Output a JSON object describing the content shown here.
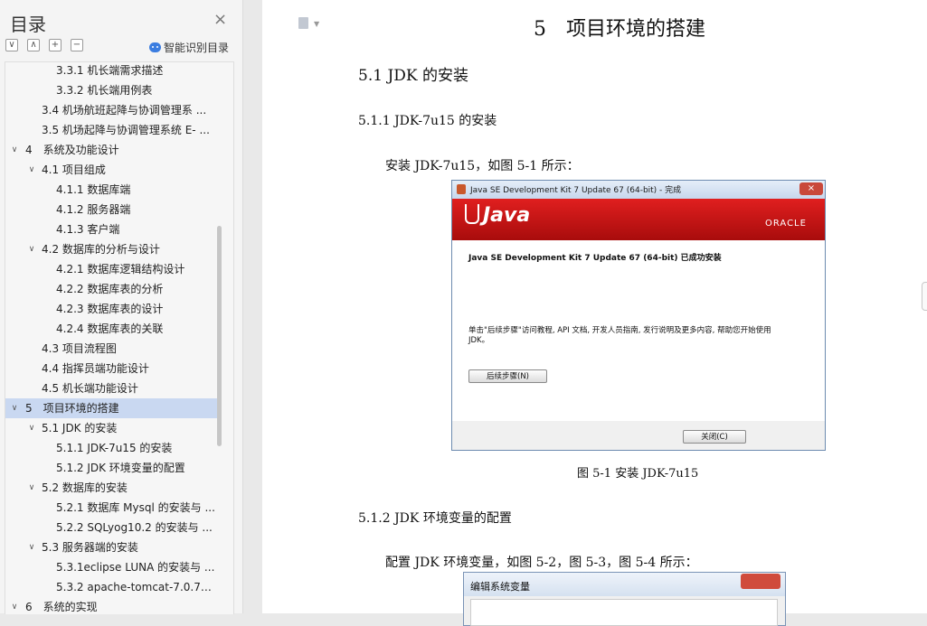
{
  "toc": {
    "title": "目录",
    "close_icon": "×",
    "tools": [
      "∨",
      "∧",
      "+",
      "−"
    ],
    "smart_label": "智能识别目录",
    "items": [
      {
        "label": "3.3.1 机长端需求描述",
        "level": 3,
        "chevron": ""
      },
      {
        "label": "3.3.2 机长端用例表",
        "level": 3,
        "chevron": ""
      },
      {
        "label": "3.4 机场航班起降与协调管理系 ...",
        "level": 2,
        "chevron": ""
      },
      {
        "label": "3.5 机场起降与协调管理系统 E- ...",
        "level": 2,
        "chevron": ""
      },
      {
        "label": "4　系统及功能设计",
        "level": 1,
        "chevron": "v"
      },
      {
        "label": "4.1  项目组成",
        "level": 2,
        "chevron": "v"
      },
      {
        "label": "4.1.1  数据库端",
        "level": 3,
        "chevron": ""
      },
      {
        "label": "4.1.2  服务器端",
        "level": 3,
        "chevron": ""
      },
      {
        "label": "4.1.3  客户端",
        "level": 3,
        "chevron": ""
      },
      {
        "label": "4.2  数据库的分析与设计",
        "level": 2,
        "chevron": "v"
      },
      {
        "label": "4.2.1  数据库逻辑结构设计",
        "level": 3,
        "chevron": ""
      },
      {
        "label": "4.2.2  数据库表的分析",
        "level": 3,
        "chevron": ""
      },
      {
        "label": "4.2.3  数据库表的设计",
        "level": 3,
        "chevron": ""
      },
      {
        "label": "4.2.4  数据库表的关联",
        "level": 3,
        "chevron": ""
      },
      {
        "label": "4.3  项目流程图",
        "level": 2,
        "chevron": ""
      },
      {
        "label": "4.4  指挥员端功能设计",
        "level": 2,
        "chevron": ""
      },
      {
        "label": "4.5  机长端功能设计",
        "level": 2,
        "chevron": ""
      },
      {
        "label": "5　项目环境的搭建",
        "level": 1,
        "chevron": "v",
        "active": true
      },
      {
        "label": "5.1 JDK 的安装",
        "level": 2,
        "chevron": "v"
      },
      {
        "label": "5.1.1 JDK-7u15 的安装",
        "level": 3,
        "chevron": ""
      },
      {
        "label": "5.1.2 JDK 环境变量的配置",
        "level": 3,
        "chevron": ""
      },
      {
        "label": "5.2  数据库的安装",
        "level": 2,
        "chevron": "v"
      },
      {
        "label": "5.2.1  数据库 Mysql 的安装与 ...",
        "level": 3,
        "chevron": ""
      },
      {
        "label": "5.2.2 SQLyog10.2 的安装与 ...",
        "level": 3,
        "chevron": ""
      },
      {
        "label": "5.3  服务器端的安装",
        "level": 2,
        "chevron": "v"
      },
      {
        "label": "5.3.1eclipse LUNA 的安装与 ...",
        "level": 3,
        "chevron": ""
      },
      {
        "label": "5.3.2 apache-tomcat-7.0.77 ...",
        "level": 3,
        "chevron": ""
      },
      {
        "label": "6　系统的实现",
        "level": 1,
        "chevron": "v"
      }
    ]
  },
  "doc": {
    "chapter_title": "5　项目环境的搭建",
    "section_title": "5.1 JDK 的安装",
    "sub1_title": "5.1.1 JDK-7u15 的安装",
    "para1": "安装 JDK-7u15，如图 5-1 所示：",
    "figure_caption": "图 5-1  安装 JDK-7u15",
    "sub2_title": "5.1.2 JDK 环境变量的配置",
    "para2": "配置 JDK 环境变量，如图 5-2，图 5-3，图 5-4 所示："
  },
  "dialog": {
    "title": "Java SE Development Kit 7 Update 67 (64-bit) - 完成",
    "close_glyph": "×",
    "java_text": "Java",
    "oracle_text": "ORACLE",
    "done_text": "Java SE Development Kit 7 Update 67 (64-bit) 已成功安装",
    "desc_text": "单击\"后续步骤\"访问教程, API 文档, 开发人员指南, 发行说明及更多内容, 帮助您开始使用 JDK。",
    "next_button": "后续步骤(N)",
    "close_button": "关闭(C)"
  },
  "dialog2": {
    "title": "编辑系统变量"
  }
}
